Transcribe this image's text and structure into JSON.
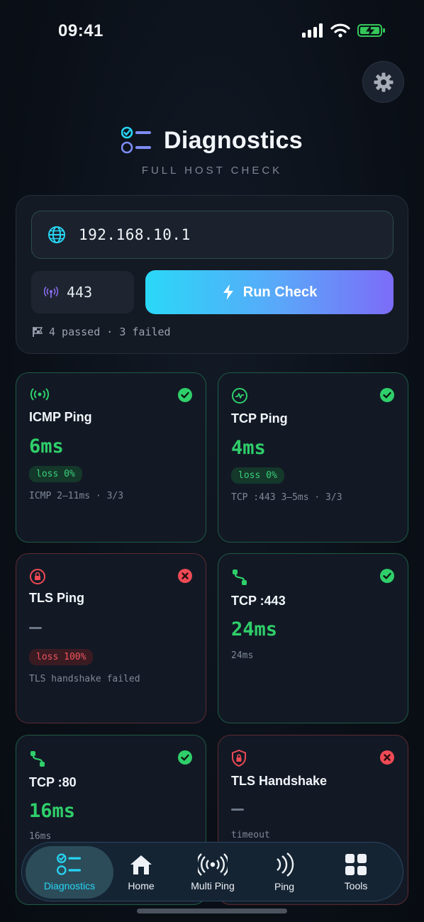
{
  "status_bar": {
    "time": "09:41"
  },
  "header": {
    "title": "Diagnostics",
    "subtitle": "FULL HOST CHECK"
  },
  "check": {
    "host": "192.168.10.1",
    "port": "443",
    "run_label": "Run Check",
    "summary": "4 passed · 3 failed"
  },
  "results": [
    {
      "name": "ICMP Ping",
      "value": "6ms",
      "badge": "loss 0%",
      "detail": "ICMP 2–11ms · 3/3",
      "status": "ok",
      "icon": "signal-icon"
    },
    {
      "name": "TCP Ping",
      "value": "4ms",
      "badge": "loss 0%",
      "detail": "TCP :443 3–5ms · 3/3",
      "status": "ok",
      "icon": "pulse-icon"
    },
    {
      "name": "TLS Ping",
      "value": "—",
      "badge": "loss 100%",
      "detail": "TLS handshake failed",
      "status": "fail",
      "icon": "lock-icon"
    },
    {
      "name": "TCP :443",
      "value": "24ms",
      "badge": "",
      "detail": "24ms",
      "status": "ok",
      "icon": "route-icon"
    },
    {
      "name": "TCP :80",
      "value": "16ms",
      "badge": "",
      "detail": "16ms",
      "status": "ok",
      "icon": "route-icon"
    },
    {
      "name": "TLS Handshake",
      "value": "—",
      "badge": "",
      "detail": "timeout",
      "status": "fail",
      "icon": "shield-lock-icon"
    }
  ],
  "tabs": [
    {
      "label": "Diagnostics",
      "icon": "checklist-icon",
      "active": true
    },
    {
      "label": "Home",
      "icon": "home-icon",
      "active": false
    },
    {
      "label": "Multi Ping",
      "icon": "broadcast-icon",
      "active": false
    },
    {
      "label": "Ping",
      "icon": "wave-icon",
      "active": false
    },
    {
      "label": "Tools",
      "icon": "grid-icon",
      "active": false
    }
  ],
  "colors": {
    "ok": "#2fcf6a",
    "fail": "#ef4a55",
    "accent": "#27d6f4"
  }
}
